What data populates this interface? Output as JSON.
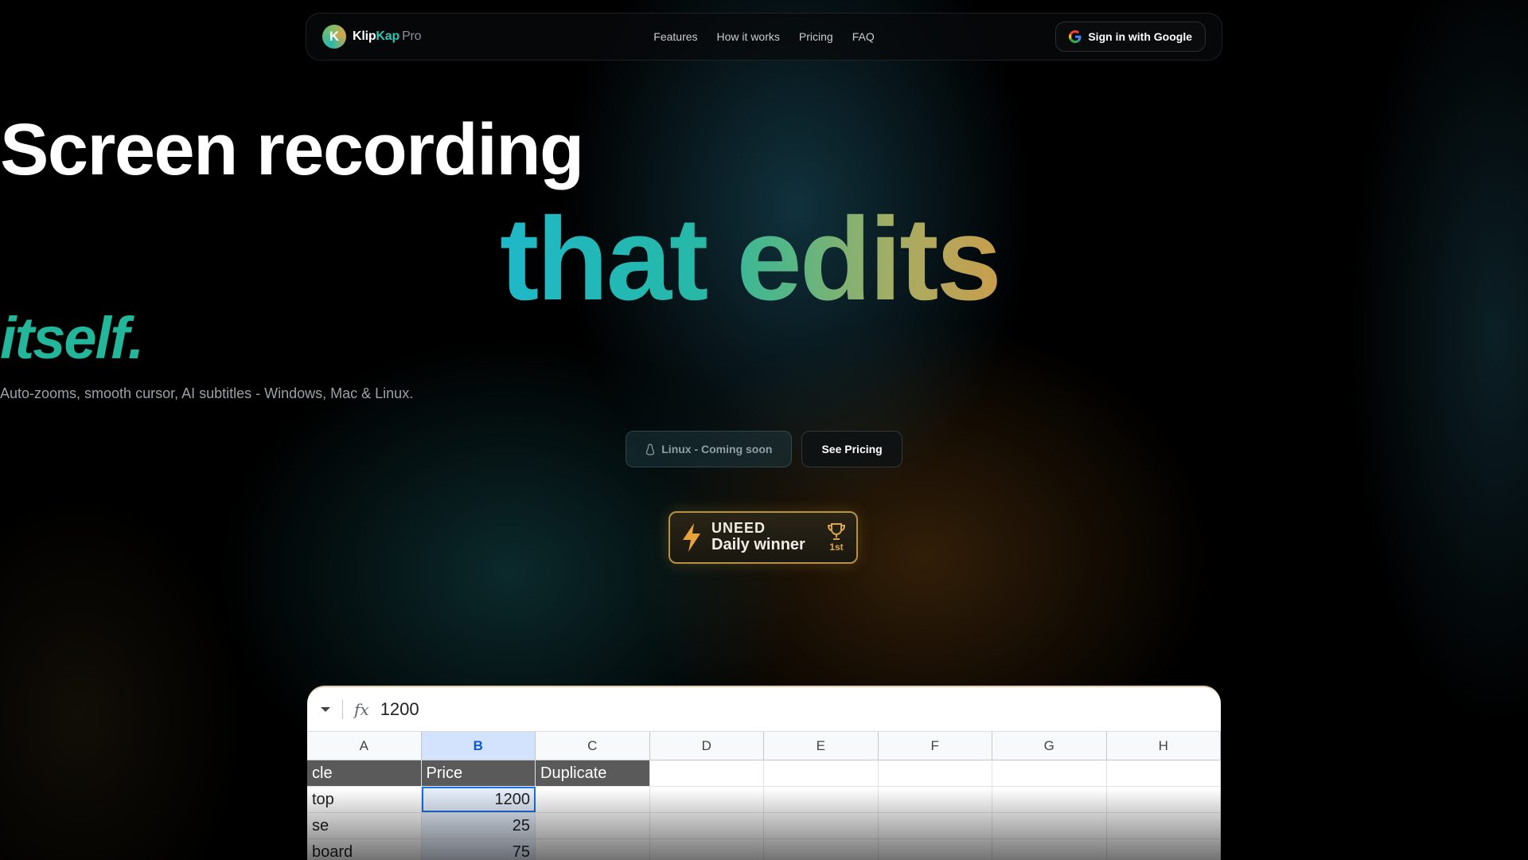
{
  "nav": {
    "brand_klip": "Klip",
    "brand_kap": "Kap",
    "brand_pro": "Pro",
    "links": [
      "Features",
      "How it works",
      "Pricing",
      "FAQ"
    ],
    "signin_label": "Sign in with Google"
  },
  "hero": {
    "line1": "Screen recording",
    "line2": "that edits",
    "line3": "itself.",
    "subtitle": "Auto-zooms, smooth cursor, AI subtitles - Windows, Mac & Linux.",
    "linux_button": "Linux - Coming soon",
    "pricing_button": "See Pricing"
  },
  "badge": {
    "brand": "UNEED",
    "title": "Daily winner",
    "rank": "1st"
  },
  "sheet": {
    "formula_value": "1200",
    "columns": [
      "A",
      "B",
      "C",
      "D",
      "E",
      "F",
      "G",
      "H"
    ],
    "selected_column": "B",
    "rows": [
      [
        "cle",
        "Price",
        "Duplicate",
        "",
        "",
        "",
        "",
        ""
      ],
      [
        "top",
        "1200",
        "",
        "",
        "",
        "",
        "",
        ""
      ],
      [
        "se",
        "25",
        "",
        "",
        "",
        "",
        "",
        ""
      ],
      [
        "board",
        "75",
        "",
        "",
        "",
        "",
        "",
        ""
      ]
    ]
  },
  "colors": {
    "accent_teal": "#2fc5b4",
    "gradient_start": "#1fb8c9",
    "gradient_end": "#d19a47",
    "badge_border": "#b59242"
  }
}
